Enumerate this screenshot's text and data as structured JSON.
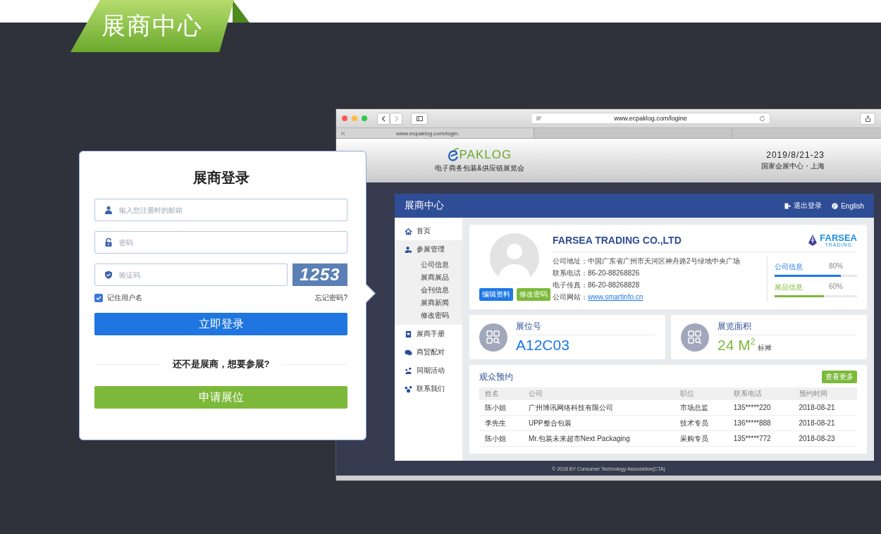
{
  "banner": {
    "title": "展商中心"
  },
  "login": {
    "title": "展商登录",
    "fields": [
      {
        "kind": "email",
        "placeholder": "输入您注册时的邮箱"
      },
      {
        "kind": "password",
        "placeholder": "密码"
      },
      {
        "kind": "captcha",
        "placeholder": "验证码",
        "code": "1253"
      }
    ],
    "remember": {
      "label": "记住用户名",
      "checked": true
    },
    "forgot": "忘记密码?",
    "login_button": "立即登录",
    "divider_text": "还不是展商，想要参展?",
    "apply_button": "申请展位"
  },
  "browser": {
    "address": "www.ecpaklog.com/logine",
    "tabs": [
      {
        "label": "www.ecpaklog.com/login."
      }
    ],
    "site_header": {
      "logo_text": "PAKLOG",
      "logo_subtitle": "电子商务包装&供应链展览会",
      "date": "2019/8/21-23",
      "venue": "国家会展中心・上海"
    },
    "footer": "© 2018 BY Consumer Technology Association(CTA)"
  },
  "dashboard": {
    "title": "展商中心",
    "header_links": [
      {
        "kind": "logout",
        "label": "退出登录"
      },
      {
        "kind": "language",
        "label": "English"
      }
    ],
    "sidebar": [
      {
        "kind": "home",
        "label": "首页"
      },
      {
        "kind": "user",
        "label": "参展管理",
        "expanded": true,
        "children": [
          {
            "label": "公司信息"
          },
          {
            "label": "展商展品"
          },
          {
            "label": "会刊信息"
          },
          {
            "label": "展商新闻"
          },
          {
            "label": "修改密码"
          }
        ]
      },
      {
        "kind": "book",
        "label": "展商手册"
      },
      {
        "kind": "chat",
        "label": "商贸配对"
      },
      {
        "kind": "people",
        "label": "同期活动"
      },
      {
        "kind": "contact",
        "label": "联系我们"
      }
    ],
    "profile": {
      "company": "FARSEA TRADING CO.,LTD",
      "brand": "FARSEA",
      "brand_sub": "TRADING",
      "buttons": [
        {
          "kind": "edit",
          "label": "编辑资料"
        },
        {
          "kind": "password",
          "label": "修改密码"
        }
      ],
      "details": [
        {
          "kind": "text",
          "label": "公司地址：",
          "value": "中国广东省广州市天河区神舟路2号绿地中央广场"
        },
        {
          "kind": "text",
          "label": "联系电话：",
          "value": "86-20-88268826"
        },
        {
          "kind": "text",
          "label": "电子传真：",
          "value": "86-20-88268828"
        },
        {
          "kind": "link",
          "label": "公司网站：",
          "value": "www.smartinfo.cn"
        }
      ],
      "progress": [
        {
          "label": "公司信息",
          "reading": "80%",
          "level": 0.8,
          "color": "#1e78e6"
        },
        {
          "label": "展品信息",
          "reading": "60%",
          "level": 0.6,
          "color": "#7cb93a"
        }
      ]
    },
    "stats": [
      {
        "label": "展位号",
        "value": "A12C03",
        "color": "#1e78e6"
      },
      {
        "label": "展览面积",
        "value": "24 M$^{2}$",
        "unit": "标摊",
        "color": "#7cb93a"
      }
    ],
    "bookings": {
      "title": "观众预约",
      "more_button": "查看更多",
      "columns": [
        "姓名",
        "公司",
        "职位",
        "联系电话",
        "预约时间"
      ],
      "rows": [
        [
          "陈小姐",
          "广州博讯网络科技有限公司",
          "市场总监",
          "135*****220",
          "2018-08-21"
        ],
        [
          "李先生",
          "UPP整合包装",
          "技术专员",
          "136*****888",
          "2018-08-21"
        ],
        [
          "陈小姐",
          "Mr.包装未来超市Next Packaging",
          "采购专员",
          "135*****772",
          "2018-08-23"
        ]
      ]
    }
  }
}
